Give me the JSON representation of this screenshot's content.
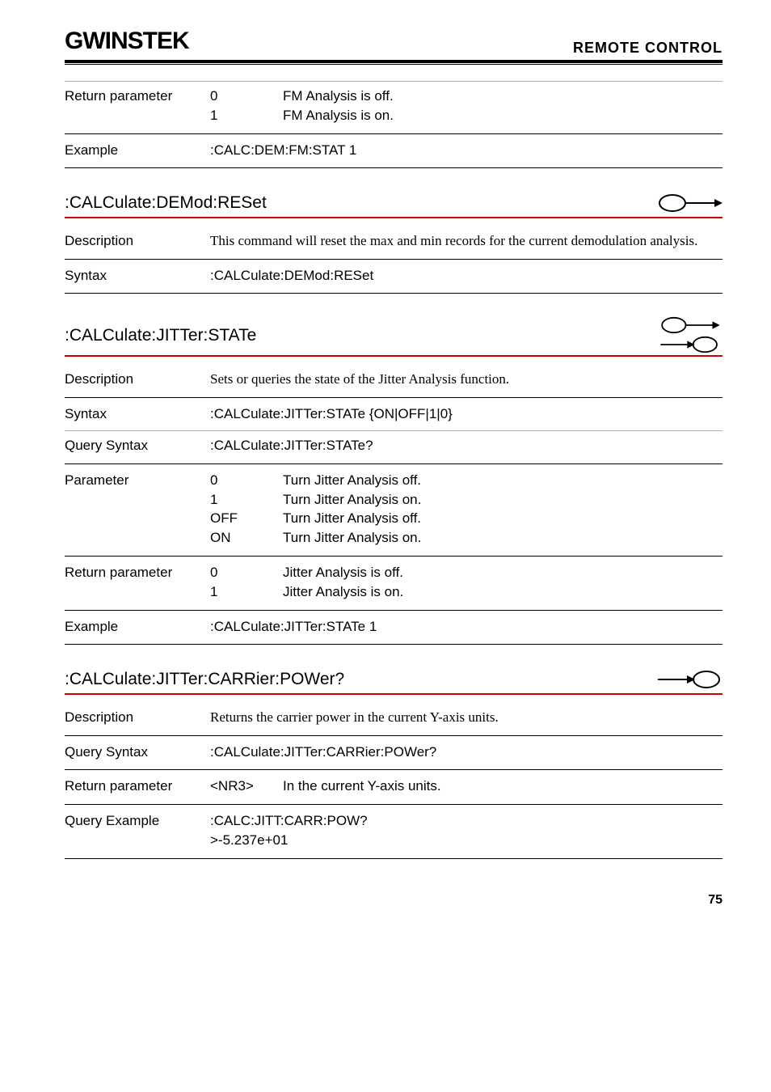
{
  "header": {
    "logo_text": "GWINSTEK",
    "title": "REMOTE CONTROL"
  },
  "top_table": {
    "return_param_label": "Return parameter",
    "rp0_key": "0",
    "rp0_val": "FM Analysis is off.",
    "rp1_key": "1",
    "rp1_val": "FM Analysis is on.",
    "example_label": "Example",
    "example_val": ":CALC:DEM:FM:STAT 1"
  },
  "cmd1": {
    "title": ":CALCulate:DEMod:RESet",
    "desc_label": "Description",
    "desc_text": "This command will reset the max and min records for the current demodulation analysis.",
    "syntax_label": "Syntax",
    "syntax_val": ":CALCulate:DEMod:RESet"
  },
  "cmd2": {
    "title": ":CALCulate:JITTer:STATe",
    "desc_label": "Description",
    "desc_text": "Sets or queries the state of the Jitter Analysis function.",
    "syntax_label": "Syntax",
    "syntax_val": ":CALCulate:JITTer:STATe {ON|OFF|1|0}",
    "qsyntax_label": "Query Syntax",
    "qsyntax_val": ":CALCulate:JITTer:STATe?",
    "param_label": "Parameter",
    "p0_key": "0",
    "p0_val": "Turn Jitter Analysis off.",
    "p1_key": "1",
    "p1_val": "Turn Jitter Analysis on.",
    "p2_key": "OFF",
    "p2_val": "Turn Jitter Analysis off.",
    "p3_key": "ON",
    "p3_val": "Turn Jitter Analysis on.",
    "rp_label": "Return parameter",
    "r0_key": "0",
    "r0_val": "Jitter Analysis is off.",
    "r1_key": "1",
    "r1_val": "Jitter Analysis is on.",
    "example_label": "Example",
    "example_val": ":CALCulate:JITTer:STATe 1"
  },
  "cmd3": {
    "title": ":CALCulate:JITTer:CARRier:POWer?",
    "desc_label": "Description",
    "desc_text": "Returns the carrier power in the current Y-axis units.",
    "qsyntax_label": "Query Syntax",
    "qsyntax_val": ":CALCulate:JITTer:CARRier:POWer?",
    "rp_label": "Return parameter",
    "rp_key": "<NR3>",
    "rp_val": "In the current Y-axis units.",
    "qex_label": "Query Example",
    "qex_line1": ":CALC:JITT:CARR:POW?",
    "qex_line2": ">-5.237e+01"
  },
  "page_num": "75"
}
